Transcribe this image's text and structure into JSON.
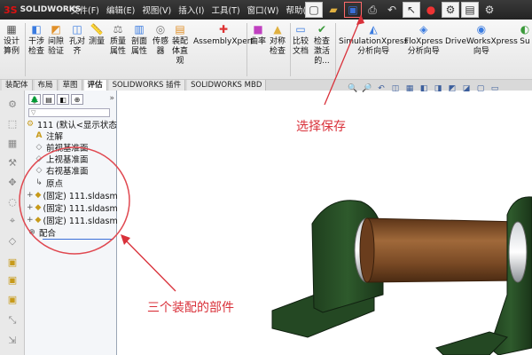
{
  "app": {
    "logo_ds": "3S",
    "logo_text": "SOLIDWORKS"
  },
  "menu": [
    "文件(F)",
    "编辑(E)",
    "视图(V)",
    "插入(I)",
    "工具(T)",
    "窗口(W)",
    "帮助(H)"
  ],
  "ribbon": {
    "tools": [
      {
        "label": "设计\n算例"
      },
      {
        "label": "干涉\n检查"
      },
      {
        "label": "间隙\n验证"
      },
      {
        "label": "孔对\n齐"
      },
      {
        "label": "测量"
      },
      {
        "label": "质量\n属性"
      },
      {
        "label": "剖面\n属性"
      },
      {
        "label": "传感\n器"
      },
      {
        "label": "装配\n体直\n观"
      },
      {
        "label": "AssemblyXpert"
      },
      {
        "label": "曲率"
      },
      {
        "label": "对称\n检查"
      },
      {
        "label": "比较\n文档"
      },
      {
        "label": "检查\n激活\n的..."
      },
      {
        "label": "SimulationXpress\n分析向导"
      },
      {
        "label": "FloXpress\n分析向导"
      },
      {
        "label": "DriveWorksXpress\n向导"
      },
      {
        "label": "Su"
      }
    ]
  },
  "tabs": [
    "装配体",
    "布局",
    "草图",
    "评估",
    "SOLIDWORKS 插件",
    "SOLIDWORKS MBD"
  ],
  "tree": {
    "filter_placeholder": "",
    "items": [
      {
        "icon": "assembly",
        "text": "111  (默认<显示状态"
      },
      {
        "icon": "annotation",
        "text": "注解"
      },
      {
        "icon": "plane",
        "text": "前视基准面"
      },
      {
        "icon": "plane",
        "text": "上视基准面"
      },
      {
        "icon": "plane",
        "text": "右视基准面"
      },
      {
        "icon": "origin",
        "text": "原点"
      },
      {
        "icon": "part",
        "text": "(固定) 111.sldasm"
      },
      {
        "icon": "part",
        "text": "(固定) 111.sldasm"
      },
      {
        "icon": "part",
        "text": "(固定) 111.sldasm"
      },
      {
        "icon": "mates",
        "text": "配合"
      }
    ]
  },
  "annotations": {
    "save": "选择保存",
    "parts": "三个装配的部件"
  },
  "colors": {
    "annotation": "#d9313a",
    "bearing_green": "#2e5a2c",
    "shaft_brown": "#7a4a25"
  }
}
